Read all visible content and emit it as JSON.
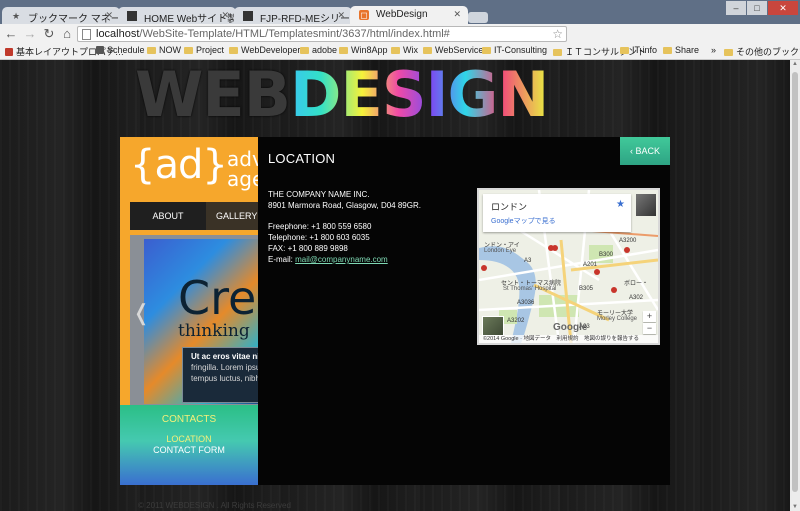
{
  "browser": {
    "tabs": [
      {
        "title": "ブックマーク マネージャ",
        "icon": "star-icon"
      },
      {
        "title": "HOME Webサイト製品カタ",
        "icon": "page-icon"
      },
      {
        "title": "FJP-RFD-MEシリーズ【従来",
        "icon": "page-icon"
      },
      {
        "title": "WebDesign",
        "icon": "webdesign-favicon"
      }
    ],
    "url_host": "localhost",
    "url_path": "/WebSite-Template/HTML/Templatesmint/3637/html/index.html#",
    "bookmarks": [
      "基本レイアウトプロパテ…",
      "Schedule",
      "NOW",
      "Project",
      "WebDeveloper",
      "adobe",
      "Win8App",
      "Wix",
      "WebService",
      "IT-Consulting",
      "ＩＴコンサルタント",
      "IT-info",
      "Share",
      "»",
      "その他のブックマーク"
    ]
  },
  "site": {
    "logo_web": "WEB",
    "logo_design": "DESIGN",
    "ad_logo": "{ad}",
    "ad_word1": "adv",
    "ad_word2": "age",
    "nav": {
      "about": "ABOUT",
      "gallery": "GALLERY"
    },
    "slide": {
      "big": "Cre",
      "sub": "thinking",
      "caption_bold": "Ut ac eros vitae nibh",
      "caption_lines": [
        "fringilla. Lorem ipsum d",
        "tempus luctus, nibh oc"
      ]
    },
    "menu": {
      "contacts": "CONTACTS",
      "location": "LOCATION",
      "contact_form": "CONTACT FORM"
    },
    "heading": "LOCATION",
    "back": "BACK",
    "address": {
      "company": "THE COMPANY NAME INC.",
      "street": "8901 Marmora Road, Glasgow, D04 89GR."
    },
    "contact": {
      "freephone": "Freephone: +1 800 559 6580",
      "telephone": "Telephone: +1 800 603 6035",
      "fax": "FAX: +1 800 889 9898",
      "email_label": "E-mail: ",
      "email": "mail@companyname.com"
    },
    "map": {
      "place": "ロンドン",
      "view_link": "Googleマップで見る",
      "labels": [
        "ンドン・アイ",
        "London Eye",
        "セント・トーマス病院",
        "St Thomas' Hospital",
        "モーリー大学",
        "Morley College",
        "ボロー・",
        "A3200",
        "B300",
        "A201",
        "B305",
        "A302",
        "A23",
        "A3036",
        "A3",
        "A3202"
      ],
      "google": "Google",
      "footer": "©2014 Google · 地図データ　利用規約　地図の誤りを報告する"
    },
    "footer": "© 2011 WEBDESIGN . All Rights Reserved"
  },
  "colors": {
    "accent_green": "#2ea484",
    "orange": "#f6a72c",
    "link": "#7ed8b3"
  }
}
